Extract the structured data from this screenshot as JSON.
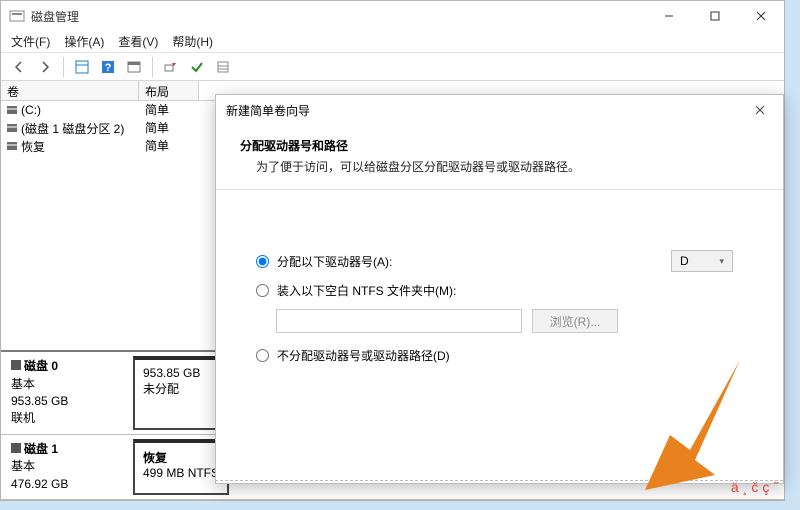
{
  "window": {
    "title": "磁盘管理",
    "menu": {
      "file": "文件(F)",
      "action": "操作(A)",
      "view": "查看(V)",
      "help": "帮助(H)"
    },
    "cols": {
      "volume": "卷",
      "layout": "布局"
    },
    "volumes": [
      {
        "name": "(C:)",
        "layout": "简单"
      },
      {
        "name": "(磁盘 1 磁盘分区 2)",
        "layout": "简单"
      },
      {
        "name": "恢复",
        "layout": "简单"
      }
    ]
  },
  "disks": [
    {
      "title": "磁盘 0",
      "type": "基本",
      "size": "953.85 GB",
      "status": "联机",
      "parts": [
        {
          "l1": "953.85 GB",
          "l2": "未分配"
        }
      ]
    },
    {
      "title": "磁盘 1",
      "type": "基本",
      "size": "476.92 GB",
      "status": "",
      "parts": [
        {
          "l1": "恢复",
          "l2": "499 MB NTFS"
        }
      ]
    }
  ],
  "dialog": {
    "title": "新建简单卷向导",
    "heading": "分配驱动器号和路径",
    "sub": "为了便于访问，可以给磁盘分区分配驱动器号或驱动器路径。",
    "opt1": "分配以下驱动器号(A):",
    "drive": "D",
    "opt2": "装入以下空白 NTFS 文件夹中(M):",
    "browse": "浏览(R)...",
    "opt3": "不分配驱动器号或驱动器路径(D)"
  },
  "watermark": "ä¸čç˝"
}
